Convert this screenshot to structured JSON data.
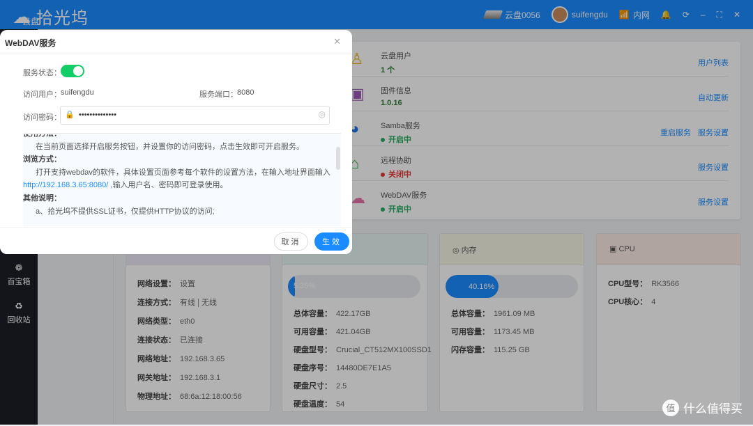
{
  "app": {
    "logo_sub": "云盘",
    "logo_name": "拾光坞"
  },
  "topbar": {
    "device": "云盘0056",
    "user": "suifengdu",
    "network": "内网",
    "icons": [
      "disk-icon",
      "avatar",
      "wifi-icon",
      "bell-icon",
      "refresh-icon",
      "minimize-icon",
      "fullscreen-icon",
      "close-icon"
    ]
  },
  "sidebar": {
    "items": [
      {
        "label": "百宝箱",
        "icon": "toolbox-icon"
      },
      {
        "label": "回收站",
        "icon": "recycle-icon"
      }
    ]
  },
  "services": [
    {
      "title": "云盘用户",
      "value": "1 个",
      "value_color": "#2e7d32",
      "icon": "user-check-icon",
      "icon_color": "#f0b429",
      "actions": [
        "用户列表"
      ]
    },
    {
      "title": "固件信息",
      "value": "1.0.16",
      "value_color": "#2e7d32",
      "icon": "chip-icon",
      "icon_color": "#9b59b6",
      "actions": [
        "自动更新"
      ]
    },
    {
      "title": "Samba服务",
      "value": "开启中",
      "status": "on",
      "value_color": "#27ae60",
      "icon": "samba-icon",
      "icon_color": "#1a73e8",
      "actions": [
        "重启服务",
        "服务设置"
      ]
    },
    {
      "title": "远程协助",
      "value": "关闭中",
      "status": "off",
      "value_color": "#e53935",
      "icon": "remote-icon",
      "icon_color": "#2e9d3a",
      "actions": [
        "服务设置"
      ]
    },
    {
      "title": "WebDAV服务",
      "value": "开启中",
      "status": "on",
      "value_color": "#27ae60",
      "icon": "cloud-icon",
      "icon_color": "#e573a8",
      "actions": [
        "服务设置"
      ]
    }
  ],
  "network_card": {
    "rows": [
      {
        "k": "网络设置：",
        "v": "设置",
        "link": true
      },
      {
        "k": "连接方式：",
        "v": "有线",
        "v2": "无线"
      },
      {
        "k": "网络类型：",
        "v": "eth0"
      },
      {
        "k": "连接状态：",
        "v": "已连接"
      },
      {
        "k": "网络地址：",
        "v": "192.168.3.65"
      },
      {
        "k": "网关地址：",
        "v": "192.168.3.1"
      },
      {
        "k": "物理地址：",
        "v": "68:6a:12:18:00:56"
      }
    ]
  },
  "disk_card": {
    "usage_percent": 5.35,
    "usage_label": "5.35%",
    "rows": [
      {
        "k": "总体容量：",
        "v": "422.17GB"
      },
      {
        "k": "可用容量：",
        "v": "421.04GB"
      },
      {
        "k": "硬盘型号：",
        "v": "Crucial_CT512MX100SSD1"
      },
      {
        "k": "硬盘序号：",
        "v": "14480DE7E1A5"
      },
      {
        "k": "硬盘尺寸：",
        "v": "2.5"
      },
      {
        "k": "硬盘温度：",
        "v": "54"
      }
    ]
  },
  "memory_card": {
    "title": "内存",
    "usage_percent": 40.16,
    "usage_label": "40.16%",
    "rows": [
      {
        "k": "总体容量：",
        "v": "1961.09 MB"
      },
      {
        "k": "可用容量：",
        "v": "1173.45 MB"
      },
      {
        "k": "闪存容量：",
        "v": "115.25 GB"
      }
    ]
  },
  "cpu_card": {
    "title": "CPU",
    "rows": [
      {
        "k": "CPU型号：",
        "v": "RK3566"
      },
      {
        "k": "CPU核心：",
        "v": "4"
      }
    ]
  },
  "modal": {
    "title": "WebDAV服务",
    "status_label": "服务状态：",
    "status_on": true,
    "user_label": "访问用户：",
    "user": "suifengdu",
    "port_label": "服务端口：",
    "port": "8080",
    "password_label": "访问密码：",
    "password_mask": "••••••••••••••",
    "help": {
      "h1": "使用方法：",
      "p1": "在当前页面选择开启服务按钮，并设置你的访问密码，点击生效即可开启服务。",
      "h2": "浏览方式：",
      "p2a": "打开支持webdav的软件，具体设置页面参考每个软件的设置方法，在输入地址界面输入 ",
      "p2link": "http://192.168.3.65:8080/",
      "p2b": " ,输入用户名、密码即可登录使用。",
      "h3": "其他说明：",
      "p3": "a、拾光坞不提供SSL证书，仅提供HTTP协议的访问;"
    },
    "cancel": "取消",
    "ok": "生效"
  },
  "watermark": "什么值得买",
  "colors": {
    "accent": "#1a8cff",
    "topbar": "#1a8cff",
    "sidebar": "#1c1f26",
    "toggle_on": "#13ce66"
  }
}
